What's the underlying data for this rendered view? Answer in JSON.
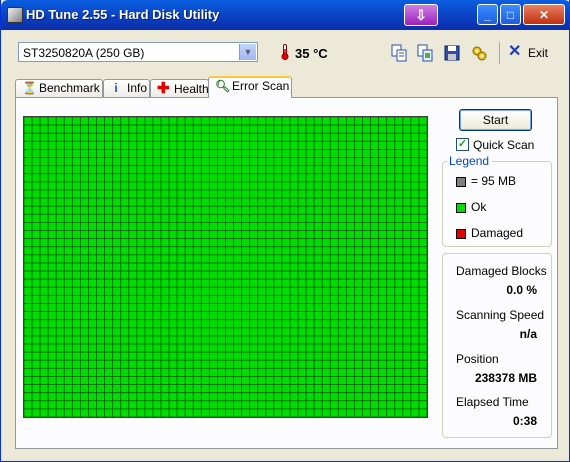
{
  "window": {
    "title": "HD Tune 2.55 - Hard Disk Utility",
    "download_icon": "download-arrow-icon",
    "controls": {
      "minimize": "_",
      "maximize": "□",
      "close": "✕"
    }
  },
  "toolbar": {
    "drive": "ST3250820A (250 GB)",
    "temperature": "35 °C",
    "icons": [
      "copy-text-icon",
      "copy-screenshot-icon",
      "save-icon",
      "options-icon"
    ],
    "exit_label": "Exit"
  },
  "tabs": [
    {
      "label": "Benchmark",
      "icon": "benchmark-icon"
    },
    {
      "label": "Info",
      "icon": "info-icon"
    },
    {
      "label": "Health",
      "icon": "health-icon"
    },
    {
      "label": "Error Scan",
      "icon": "magnifier-icon"
    }
  ],
  "scan": {
    "start_label": "Start",
    "quick_scan_label": "Quick Scan",
    "quick_scan_checked": true,
    "block_columns": 50,
    "block_rows": 37,
    "block_color": "#00dd00",
    "block_border": "#006600"
  },
  "legend": {
    "title": "Legend",
    "items": [
      {
        "label": "= 95 MB",
        "color": "#7f7f7f"
      },
      {
        "label": "Ok",
        "color": "#00dd00"
      },
      {
        "label": "Damaged",
        "color": "#e00000"
      }
    ]
  },
  "stats": {
    "damaged_blocks_label": "Damaged Blocks",
    "damaged_blocks_value": "0.0 %",
    "scanning_speed_label": "Scanning Speed",
    "scanning_speed_value": "n/a",
    "position_label": "Position",
    "position_value": "238378 MB",
    "elapsed_time_label": "Elapsed Time",
    "elapsed_time_value": "0:38"
  }
}
